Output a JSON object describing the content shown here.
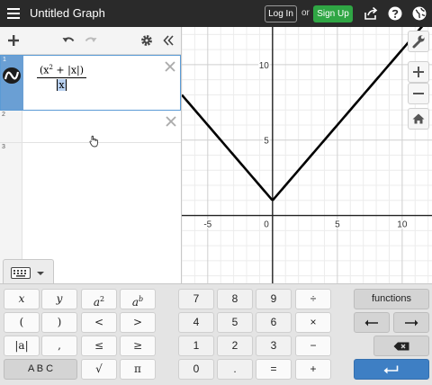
{
  "header": {
    "title": "Untitled Graph",
    "login_label": "Log In",
    "or_text": "or",
    "signup_label": "Sign Up",
    "menu_icon": "hamburger-menu-icon",
    "share_icon": "share-icon",
    "help_icon": "help-icon",
    "language_icon": "globe-icon",
    "signup_color": "#2fa644"
  },
  "expression_toolbar": {
    "add_icon": "plus-icon",
    "undo_icon": "undo-icon",
    "redo_icon": "redo-icon",
    "settings_icon": "gear-icon",
    "collapse_icon": "double-chevron-left-icon"
  },
  "expressions": [
    {
      "index": "1",
      "numerator_open": "(x",
      "numerator_exp": "2",
      "numerator_rest": " + |x|)",
      "denominator": "x",
      "selected": true,
      "color": "#000000"
    },
    {
      "index": "2"
    },
    {
      "index": "3"
    }
  ],
  "graph": {
    "x_range": [
      -7,
      12.3
    ],
    "y_range": [
      -4.5,
      12.5
    ],
    "x_ticks": [
      "-5",
      "0",
      "5",
      "10"
    ],
    "y_ticks": [
      "5",
      "10"
    ],
    "origin_label": "0",
    "curve": "y = (x^2 + |x|) / |x|",
    "curve_color": "#000000",
    "controls": [
      "wrench-icon",
      "zoom-in-icon",
      "zoom-out-icon",
      "home-icon"
    ]
  },
  "keypad": {
    "keyboard_icon": "keyboard-icon",
    "keys": {
      "x": "x",
      "y": "y",
      "a": "a",
      "sq": "2",
      "b": "b",
      "lparen": "(",
      "rparen": ")",
      "lt": "<",
      "gt": ">",
      "abs": "|a|",
      "comma": ",",
      "le": "≤",
      "ge": "≥",
      "abc": "A B C",
      "sqrt": "√",
      "pi": "π",
      "n7": "7",
      "n8": "8",
      "n9": "9",
      "div": "÷",
      "n4": "4",
      "n5": "5",
      "n6": "6",
      "mul": "×",
      "n1": "1",
      "n2": "2",
      "n3": "3",
      "minus": "−",
      "n0": "0",
      "dot": ".",
      "eq": "=",
      "plus": "+",
      "functions": "functions"
    },
    "enter_color": "#3e7fc4"
  }
}
